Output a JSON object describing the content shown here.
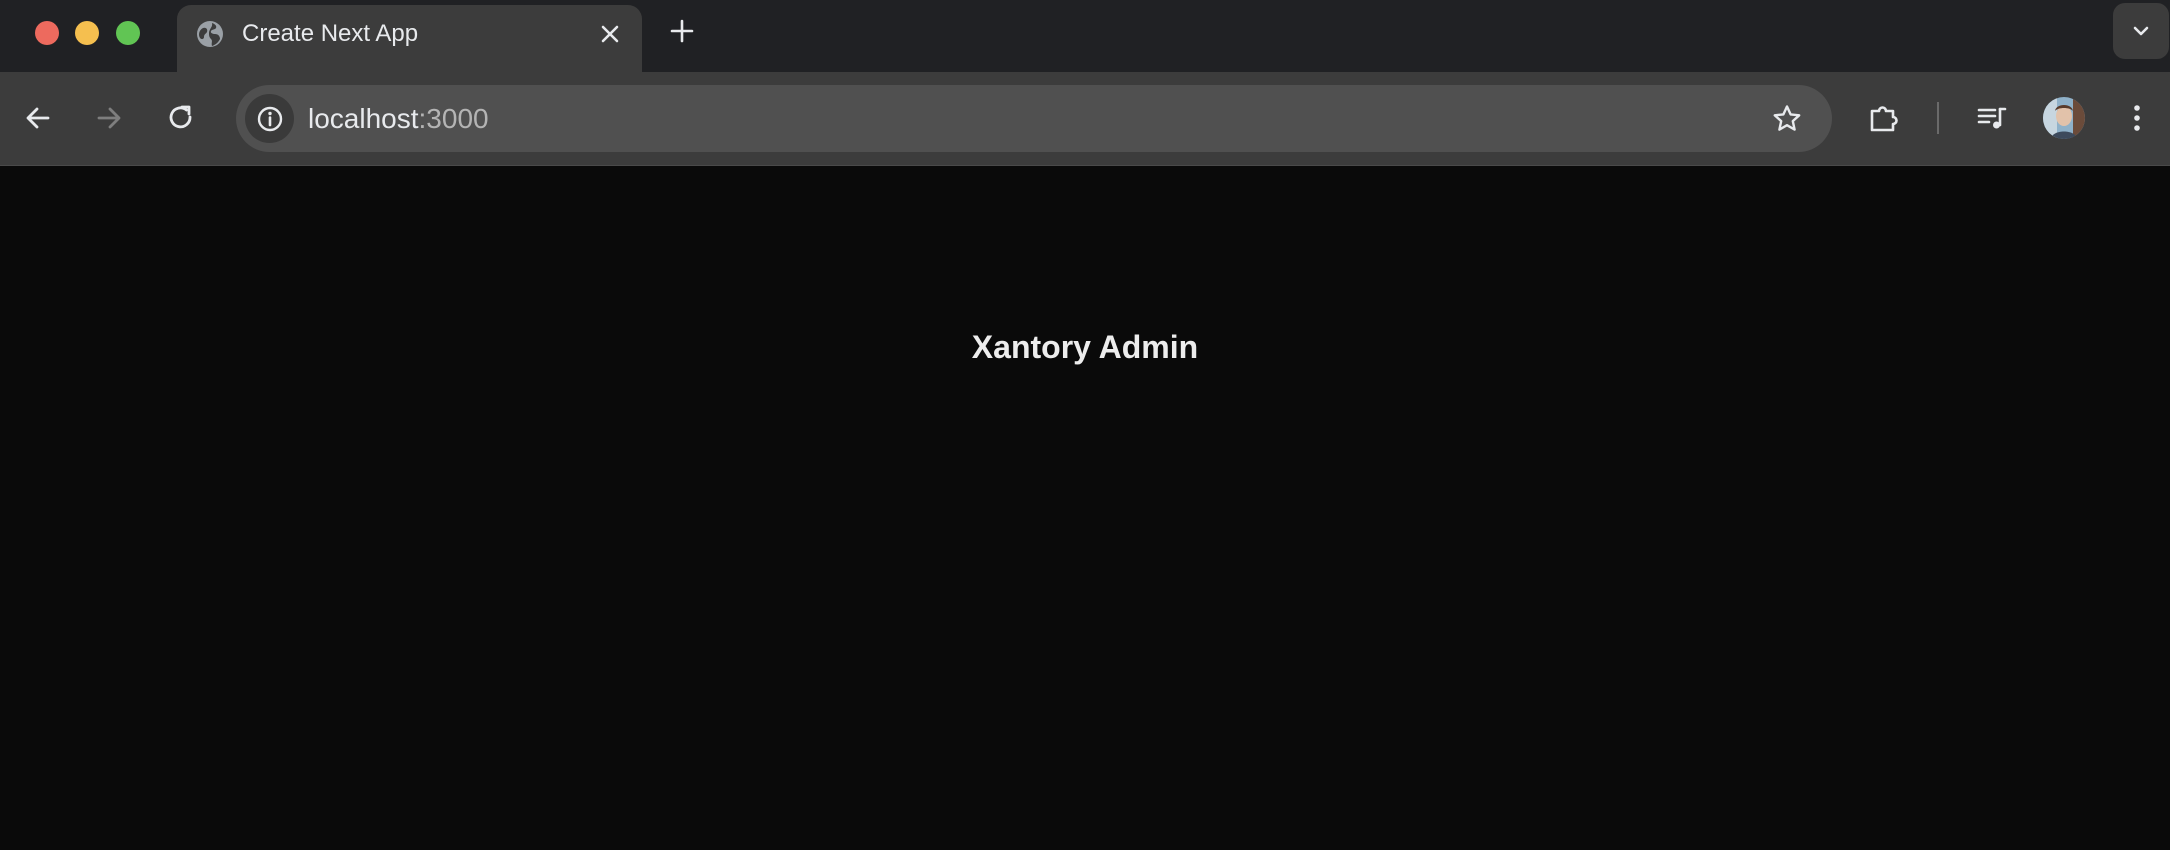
{
  "window": {
    "controls": [
      "close",
      "minimize",
      "maximize"
    ],
    "colors": {
      "close": "#ed6a5e",
      "minimize": "#f5bf4f",
      "maximize": "#61c554"
    }
  },
  "tabs": [
    {
      "title": "Create Next App",
      "favicon": "globe-icon",
      "active": true
    }
  ],
  "toolbar": {
    "url_host": "localhost",
    "url_port": ":3000",
    "icons": [
      "back-arrow-icon",
      "forward-arrow-icon",
      "reload-icon",
      "info-icon",
      "star-icon",
      "puzzle-icon",
      "media-queue-icon",
      "profile-avatar",
      "kebab-menu-icon"
    ]
  },
  "page": {
    "heading": "Xantory Admin",
    "background": "#0a0a0a"
  }
}
